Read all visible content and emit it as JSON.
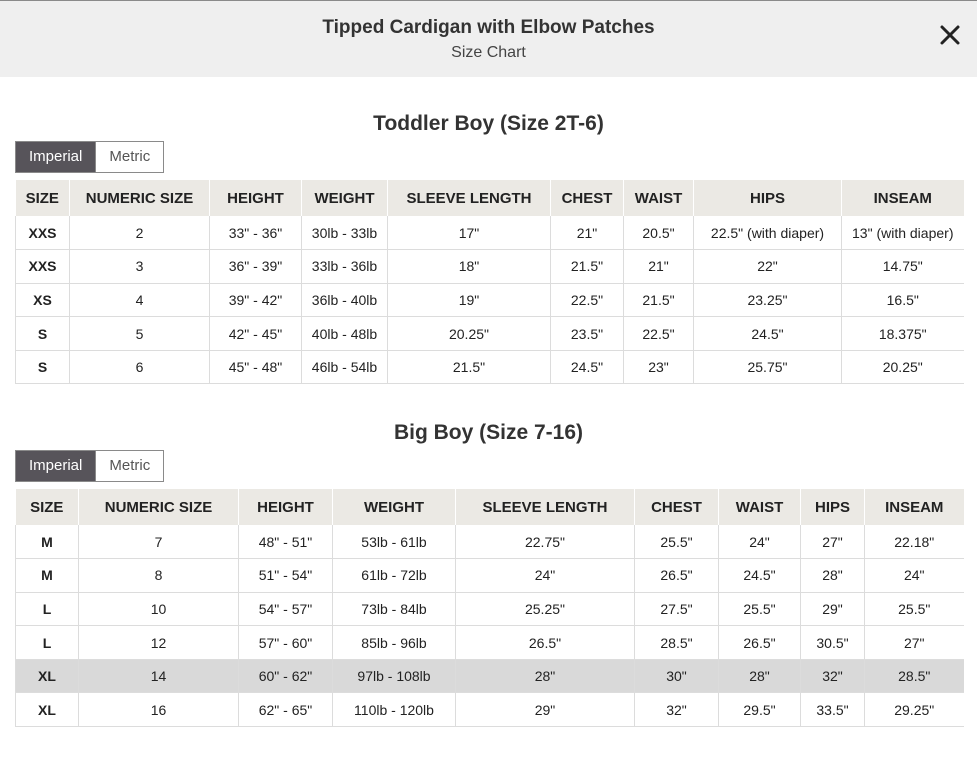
{
  "header": {
    "title": "Tipped Cardigan with Elbow Patches",
    "subtitle": "Size Chart",
    "close_icon": "close-icon"
  },
  "toddler": {
    "title": "Toddler Boy (Size 2T-6)",
    "unit_toggle": {
      "imperial": "Imperial",
      "metric": "Metric",
      "selected": "Imperial"
    },
    "columns": [
      "SIZE",
      "NUMERIC SIZE",
      "HEIGHT",
      "WEIGHT",
      "SLEEVE LENGTH",
      "CHEST",
      "WAIST",
      "HIPS",
      "INSEAM"
    ],
    "rows": [
      [
        "XXS",
        "2",
        "33\" - 36\"",
        "30lb - 33lb",
        "17\"",
        "21\"",
        "20.5\"",
        "22.5\" (with diaper)",
        "13\" (with diaper)"
      ],
      [
        "XXS",
        "3",
        "36\" - 39\"",
        "33lb - 36lb",
        "18\"",
        "21.5\"",
        "21\"",
        "22\"",
        "14.75\""
      ],
      [
        "XS",
        "4",
        "39\" - 42\"",
        "36lb - 40lb",
        "19\"",
        "22.5\"",
        "21.5\"",
        "23.25\"",
        "16.5\""
      ],
      [
        "S",
        "5",
        "42\" - 45\"",
        "40lb - 48lb",
        "20.25\"",
        "23.5\"",
        "22.5\"",
        "24.5\"",
        "18.375\""
      ],
      [
        "S",
        "6",
        "45\" - 48\"",
        "46lb - 54lb",
        "21.5\"",
        "24.5\"",
        "23\"",
        "25.75\"",
        "20.25\""
      ]
    ]
  },
  "big": {
    "title": "Big Boy (Size 7-16)",
    "unit_toggle": {
      "imperial": "Imperial",
      "metric": "Metric",
      "selected": "Imperial"
    },
    "columns": [
      "SIZE",
      "NUMERIC SIZE",
      "HEIGHT",
      "WEIGHT",
      "SLEEVE LENGTH",
      "CHEST",
      "WAIST",
      "HIPS",
      "INSEAM"
    ],
    "rows": [
      [
        "M",
        "7",
        "48\" - 51\"",
        "53lb - 61lb",
        "22.75\"",
        "25.5\"",
        "24\"",
        "27\"",
        "22.18\""
      ],
      [
        "M",
        "8",
        "51\" - 54\"",
        "61lb - 72lb",
        "24\"",
        "26.5\"",
        "24.5\"",
        "28\"",
        "24\""
      ],
      [
        "L",
        "10",
        "54\" - 57\"",
        "73lb - 84lb",
        "25.25\"",
        "27.5\"",
        "25.5\"",
        "29\"",
        "25.5\""
      ],
      [
        "L",
        "12",
        "57\" - 60\"",
        "85lb - 96lb",
        "26.5\"",
        "28.5\"",
        "26.5\"",
        "30.5\"",
        "27\""
      ],
      [
        "XL",
        "14",
        "60\" - 62\"",
        "97lb - 108lb",
        "28\"",
        "30\"",
        "28\"",
        "32\"",
        "28.5\""
      ],
      [
        "XL",
        "16",
        "62\" - 65\"",
        "110lb - 120lb",
        "29\"",
        "32\"",
        "29.5\"",
        "33.5\"",
        "29.25\""
      ]
    ],
    "highlighted_row": 4
  }
}
